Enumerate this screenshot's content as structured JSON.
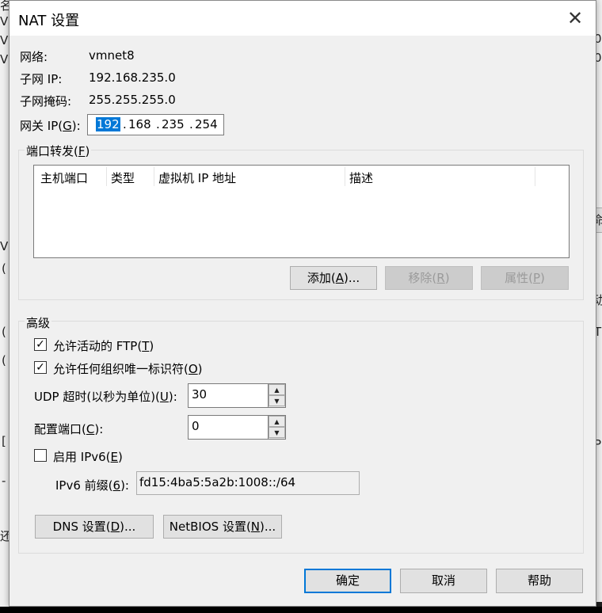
{
  "background": {
    "left_glyphs": [
      "名",
      "V",
      "V",
      "V",
      "(",
      "(",
      "(",
      "[",
      "-",
      "还"
    ],
    "right_glyphs": [
      "0",
      "0",
      "命",
      "动",
      "T",
      "P"
    ]
  },
  "dialog": {
    "title": "NAT 设置",
    "close_glyph": "✕",
    "network_label": "网络:",
    "network_value": "vmnet8",
    "subnet_ip_label": "子网 IP:",
    "subnet_ip_value": "192.168.235.0",
    "subnet_mask_label": "子网掩码:",
    "subnet_mask_value": "255.255.255.0",
    "gateway_label_pre": "网关 IP(",
    "gateway_label_key": "G",
    "gateway_label_post": "):",
    "gateway_octets": [
      "192",
      "168",
      "235",
      "254"
    ],
    "port_forward": {
      "title_pre": "端口转发(",
      "title_key": "F",
      "title_post": ")",
      "columns": [
        "主机端口",
        "类型",
        "虚拟机 IP 地址",
        "描述"
      ],
      "rows": [],
      "add_pre": "添加(",
      "add_key": "A",
      "add_post": ")...",
      "remove_pre": "移除(",
      "remove_key": "R",
      "remove_post": ")",
      "props_pre": "属性(",
      "props_key": "P",
      "props_post": ")"
    },
    "advanced": {
      "title": "高级",
      "ftp_pre": "允许活动的 FTP(",
      "ftp_key": "T",
      "ftp_post": ")",
      "ftp_checked": true,
      "oui_pre": "允许任何组织唯一标识符(",
      "oui_key": "O",
      "oui_post": ")",
      "oui_checked": true,
      "udp_pre": "UDP 超时(以秒为单位)(",
      "udp_key": "U",
      "udp_post": "):",
      "udp_value": "30",
      "cfgport_pre": "配置端口(",
      "cfgport_key": "C",
      "cfgport_post": "):",
      "cfgport_value": "0",
      "ipv6_pre": "启用 IPv6(",
      "ipv6_key": "E",
      "ipv6_post": ")",
      "ipv6_checked": false,
      "ipv6_prefix_pre": "IPv6 前缀(",
      "ipv6_prefix_key": "6",
      "ipv6_prefix_post": "):",
      "ipv6_prefix_value": "fd15:4ba5:5a2b:1008::/64",
      "dns_pre": "DNS 设置(",
      "dns_key": "D",
      "dns_post": ")...",
      "netbios_pre": "NetBIOS 设置(",
      "netbios_key": "N",
      "netbios_post": ")..."
    },
    "ok_label": "确定",
    "cancel_label": "取消",
    "help_label": "帮助"
  }
}
